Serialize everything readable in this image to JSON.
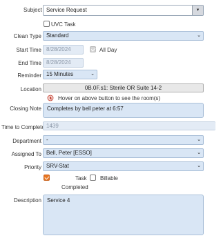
{
  "subject": {
    "label": "Subject",
    "value": "Service Request"
  },
  "uvc_task": {
    "label": "UVC Task",
    "checked": false
  },
  "clean_type": {
    "label": "Clean Type",
    "value": "Standard"
  },
  "start_time": {
    "label": "Start Time",
    "value": "8/28/2024"
  },
  "all_day": {
    "label": "All Day",
    "checked": true
  },
  "end_time": {
    "label": "End Time",
    "value": "8/28/2024"
  },
  "reminder": {
    "label": "Reminder",
    "value": "15 Minutes"
  },
  "location": {
    "label": "Location",
    "value": "0B.0F.s1: Sterile OR Suite 14-2",
    "hint": "Hover on above button to see the room(s)"
  },
  "closing_note": {
    "label": "Closing Note",
    "value": "Completes by bell peter at 6:57"
  },
  "time_to_complete": {
    "label": "Time to Complete",
    "value": "1439"
  },
  "department": {
    "label": "Department",
    "value": "-"
  },
  "assigned_to": {
    "label": "Assigned To",
    "value": "Bell, Peter [ESSO]"
  },
  "priority": {
    "label": "Priority",
    "value": "SRV-Stat"
  },
  "task": {
    "label": "Task",
    "checked": true
  },
  "billable": {
    "label": "Billable",
    "checked": false
  },
  "completed_label": "Completed",
  "description": {
    "label": "Description",
    "value": "Service 4"
  },
  "colors": {
    "field_bg": "#d9e6f5",
    "checkbox_on": "#e87722"
  },
  "icons": {
    "dropdown": "chevron-down-icon",
    "hover": "pointer-icon"
  }
}
